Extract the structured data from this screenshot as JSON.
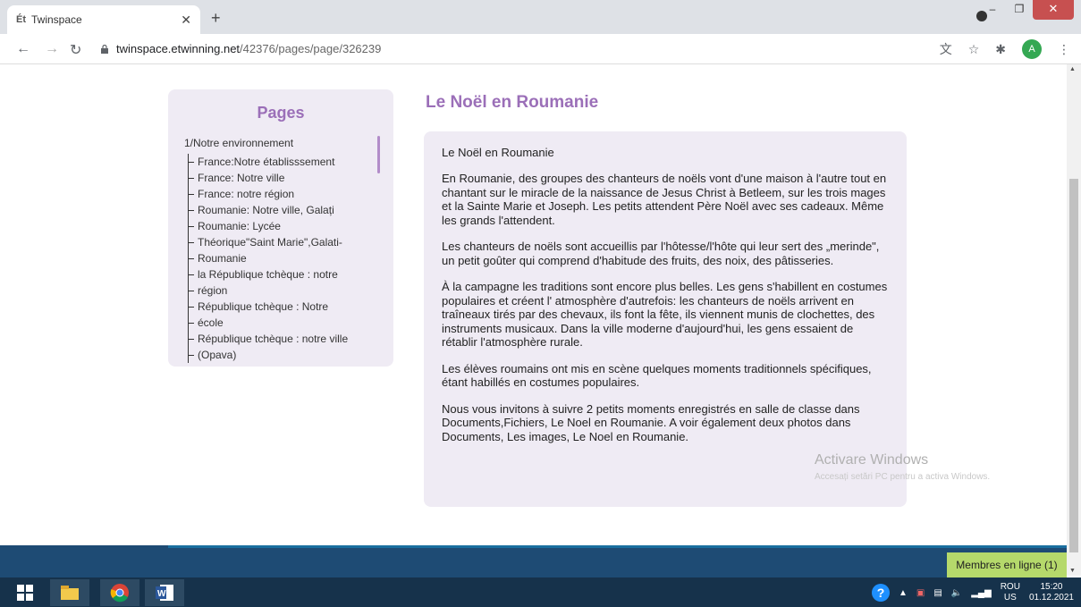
{
  "browser": {
    "tab_title": "Twinspace",
    "tab_favicon": "Ét",
    "url_host": "twinspace.etwinning.net",
    "url_path": "/42376/pages/page/326239",
    "avatar_letter": "A"
  },
  "sidebar": {
    "title": "Pages",
    "root_label": "1/Notre environnement",
    "items": [
      "France:Notre établisssement",
      "France: Notre ville",
      "France: notre région",
      "Roumanie: Notre ville, Galați",
      "Roumanie: Lycée",
      "Théorique\"Saint Marie\",Galati-",
      "Roumanie",
      "la République tchèque : notre",
      "région",
      "République tchèque : Notre",
      "école",
      "République tchèque : notre ville",
      "(Opava)"
    ]
  },
  "article": {
    "title": "Le Noël en Roumanie",
    "heading": "Le Noël en Roumanie",
    "paragraphs": [
      "En Roumanie, des groupes des chanteurs de noëls vont d'une maison à l'autre tout en chantant sur le miracle de la naissance de Jesus Christ à Betleem, sur les trois mages et la Sainte Marie et Joseph. Les petits attendent Père Noël avec ses cadeaux. Même les grands l'attendent.",
      " Les chanteurs de noëls sont accueillis par l'hôtesse/l'hôte qui leur sert des „merinde\", un petit goûter qui comprend d'habitude des fruits, des noix, des pâtisseries.",
      "À la campagne les traditions sont encore plus belles. Les gens s'habillent en costumes populaires et créent l' atmosphère d'autrefois: les chanteurs de noëls arrivent en traîneaux tirés par des chevaux, ils font la fête, ils viennent munis de clochettes, des instruments musicaux. Dans la ville moderne d'aujourd'hui, les gens essaient de rétablir l'atmosphère rurale.",
      "Les élèves roumains ont mis en scène quelques moments traditionnels spécifiques, étant habillés en costumes populaires.",
      "Nous vous invitons à suivre 2 petits moments enregistrés en salle de classe dans Documents,Fichiers, Le Noel en Roumanie. A voir également deux photos dans Documents, Les images, Le Noel en Roumanie."
    ]
  },
  "watermark": {
    "title": "Activare Windows",
    "subtitle": "Accesați setări PC pentru a activa Windows."
  },
  "members_button": "Membres en ligne (1)",
  "taskbar": {
    "lang_top": "ROU",
    "lang_bottom": "US",
    "time": "15:20",
    "date": "01.12.2021"
  }
}
